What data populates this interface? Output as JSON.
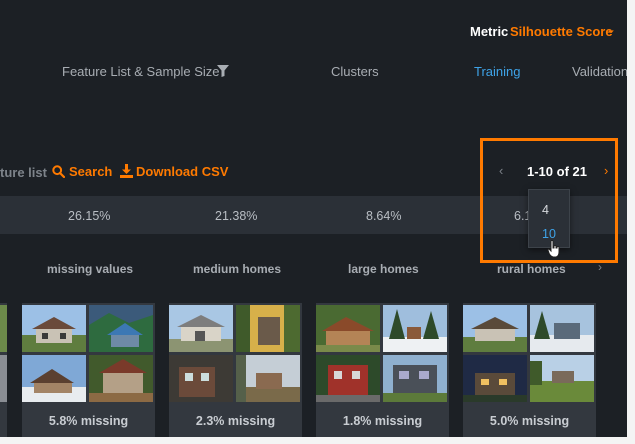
{
  "header": {
    "metric_label": "Metric",
    "metric_value": "Silhouette Score",
    "metric_chevron": "chevron-down-icon"
  },
  "columns": {
    "feature_list": "Feature List & Sample Size",
    "clusters": "Clusters",
    "training": "Training",
    "validation": "Validation"
  },
  "toolbar": {
    "feature_list_partial": "ture list",
    "search_label": "Search",
    "download_label": "Download CSV"
  },
  "pagination": {
    "range": "1-10 of 21",
    "page_size_options": [
      "4",
      "10"
    ],
    "selected_page_size": "10"
  },
  "scores": [
    "26.15%",
    "21.38%",
    "8.64%",
    "6.1"
  ],
  "clusters": [
    {
      "name": "missing values",
      "missing": "5.8% missing"
    },
    {
      "name": "medium homes",
      "missing": "2.3% missing"
    },
    {
      "name": "large homes",
      "missing": "1.8% missing"
    },
    {
      "name": "rural homes",
      "missing": "5.0% missing"
    }
  ],
  "colors": {
    "accent": "#ff7a00",
    "link": "#3ea3e8",
    "background": "#1c2025"
  }
}
